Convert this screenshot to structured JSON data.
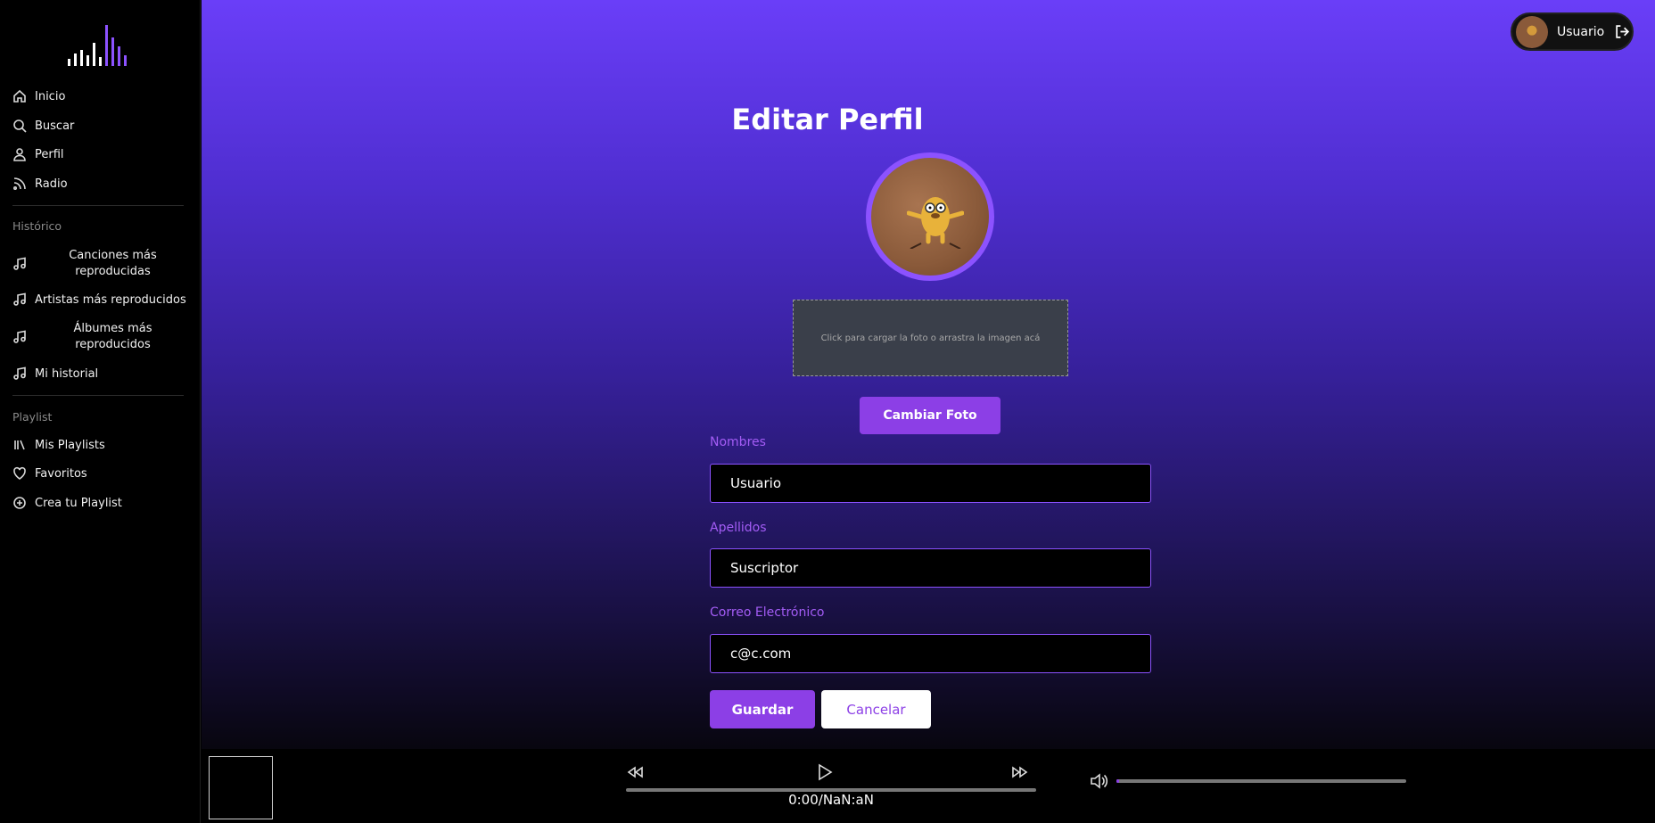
{
  "sidebar": {
    "nav": [
      {
        "label": "Inicio",
        "icon": "home-icon"
      },
      {
        "label": "Buscar",
        "icon": "search-icon"
      },
      {
        "label": "Perfil",
        "icon": "user-icon"
      },
      {
        "label": "Radio",
        "icon": "rss-icon"
      }
    ],
    "history_title": "Histórico",
    "history": [
      {
        "label": "Canciones más reproducidas",
        "icon": "music-note-icon"
      },
      {
        "label": "Artistas más reproducidos",
        "icon": "music-note-icon"
      },
      {
        "label": "Álbumes más reproducidos",
        "icon": "music-note-icon"
      },
      {
        "label": "Mi historial",
        "icon": "music-note-icon"
      }
    ],
    "playlist_title": "Playlist",
    "playlist": [
      {
        "label": "Mis Playlists",
        "icon": "library-icon"
      },
      {
        "label": "Favoritos",
        "icon": "heart-icon"
      },
      {
        "label": "Crea tu Playlist",
        "icon": "plus-circle-icon"
      }
    ]
  },
  "header": {
    "username": "Usuario"
  },
  "main": {
    "title": "Editar Perfil",
    "dropzone_text": "Click para cargar la foto o arrastra la imagen acá",
    "change_photo_label": "Cambiar Foto",
    "fields": [
      {
        "label": "Nombres",
        "value": "Usuario"
      },
      {
        "label": "Apellidos",
        "value": "Suscriptor"
      },
      {
        "label": "Correo Electrónico",
        "value": "c@c.com"
      }
    ],
    "save_label": "Guardar",
    "cancel_label": "Cancelar"
  },
  "player": {
    "time": "0:00/NaN:aN",
    "progress": 0,
    "volume": 0.01
  },
  "colors": {
    "accent": "#8c3fe6",
    "gradient_top": "#6a3ef8",
    "gradient_bottom": "#08060f"
  }
}
